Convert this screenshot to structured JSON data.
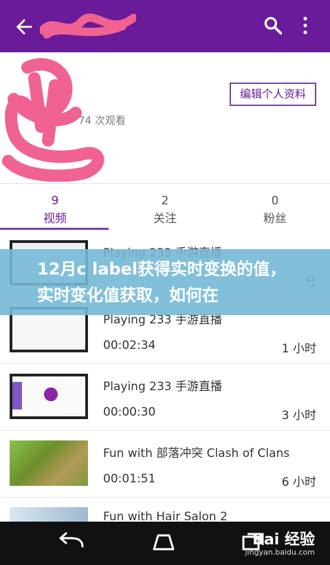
{
  "colors": {
    "primary": "#6a1b9a",
    "scribble": "#f06292",
    "banner": "#74b9d6"
  },
  "appbar": {
    "back_icon": "arrow-left-icon",
    "search_icon": "search-icon",
    "more_icon": "more-vert-icon"
  },
  "profile": {
    "views": "74 次观看",
    "edit_button": "编辑个人资料"
  },
  "stats": [
    {
      "count": "9",
      "label": "视频"
    },
    {
      "count": "2",
      "label": "关注"
    },
    {
      "count": "0",
      "label": "粉丝"
    }
  ],
  "videos": [
    {
      "title": "Playing 233 手游直播",
      "duration": "",
      "time": "分"
    },
    {
      "title": "Playing 233 手游直播",
      "duration": "00:02:34",
      "time": "1 小时"
    },
    {
      "title": "Playing 233 手游直播",
      "duration": "00:00:30",
      "time": "3 小时"
    },
    {
      "title": "Fun with 部落冲突 Clash of Clans",
      "duration": "00:01:51",
      "time": "6 小时"
    },
    {
      "title": "Fun with Hair Salon 2",
      "duration": "",
      "time": ""
    }
  ],
  "banner": {
    "text": "12月c label获得实时变换的值，实时变化值获取，如何在"
  },
  "watermark": {
    "logo": "Bai 经验",
    "url": "jingyan.baidu.com"
  }
}
